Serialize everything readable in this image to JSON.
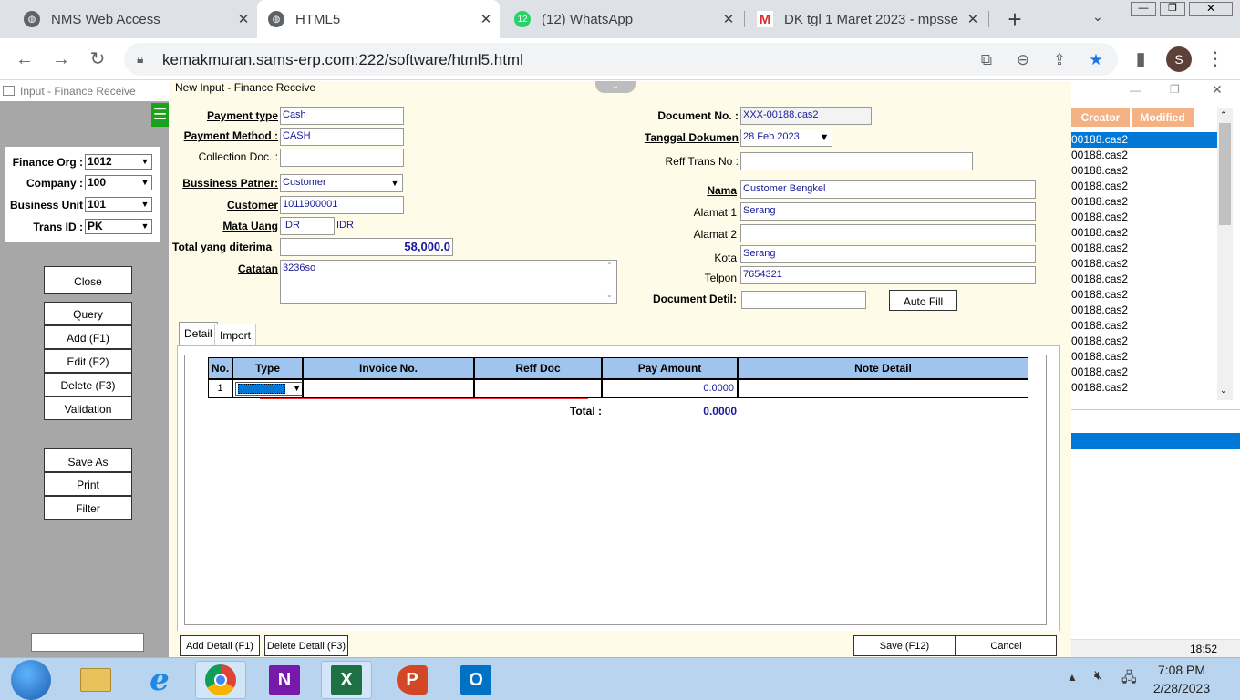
{
  "browser": {
    "tabs": [
      {
        "title": "NMS Web Access",
        "active": false
      },
      {
        "title": "HTML5",
        "active": true
      },
      {
        "title": "(12) WhatsApp",
        "active": false,
        "badge": "12"
      },
      {
        "title": "DK tgl 1 Maret 2023 - mpsse",
        "active": false
      }
    ],
    "new_tab": "+",
    "url": "kemakmuran.sams-erp.com:222/software/html5.html",
    "profile_initial": "S"
  },
  "left": {
    "title": "Input - Finance Receive",
    "filters": [
      {
        "label": "Finance Org :",
        "value": "1012"
      },
      {
        "label": "Company :",
        "value": "100"
      },
      {
        "label": "Business Unit",
        "value": "101"
      },
      {
        "label": "Trans ID :",
        "value": "PK"
      }
    ],
    "buttons": {
      "close": "Close",
      "query": "Query",
      "add": "Add (F1)",
      "edit": "Edit (F2)",
      "delete": "Delete (F3)",
      "validation": "Validation",
      "save_as": "Save As",
      "print": "Print",
      "filter": "Filter"
    }
  },
  "form": {
    "window_title": "New Input - Finance Receive",
    "payment_type": {
      "label": "Payment type",
      "value": "Cash"
    },
    "payment_method": {
      "label": "Payment Method :",
      "value": "CASH"
    },
    "collection_doc": {
      "label": "Collection Doc. :",
      "value": ""
    },
    "business_partner": {
      "label": "Bussiness Patner:",
      "value": "Customer"
    },
    "customer": {
      "label": "Customer",
      "value": "1011900001"
    },
    "currency": {
      "label": "Mata Uang",
      "value": "IDR",
      "display": "IDR"
    },
    "total": {
      "label": "Total yang diterima",
      "value": "58,000.0"
    },
    "notes": {
      "label": "Catatan",
      "value": "3236so"
    },
    "document_no": {
      "label": "Document No. :",
      "value": "XXX-00188.cas2"
    },
    "doc_date": {
      "label": "Tanggal Dokumen",
      "value": "28 Feb 2023"
    },
    "reff_trans_no": {
      "label": "Reff Trans No :",
      "value": ""
    },
    "name": {
      "label": "Nama",
      "value": "Customer Bengkel"
    },
    "address1": {
      "label": "Alamat 1",
      "value": "Serang"
    },
    "address2": {
      "label": "Alamat 2",
      "value": ""
    },
    "city": {
      "label": "Kota",
      "value": "Serang"
    },
    "phone": {
      "label": "Telpon",
      "value": "7654321"
    },
    "document_detail": {
      "label": "Document Detil:",
      "value": ""
    },
    "auto_fill": "Auto Fill"
  },
  "detail": {
    "tabs": [
      "Detail",
      "Import"
    ],
    "columns": [
      "No.",
      "Type",
      "Invoice No.",
      "Reff Doc",
      "Pay Amount",
      "Note Detail"
    ],
    "rows": [
      {
        "no": "1",
        "type": "",
        "invoice": "",
        "reff": "",
        "amount": "0.0000",
        "note": ""
      }
    ],
    "total_label": "Total :",
    "total_value": "0.0000",
    "add_detail": "Add Detail (F1)",
    "delete_detail": "Delete Detail (F3)",
    "save": "Save (F12)",
    "cancel": "Cancel"
  },
  "right": {
    "columns": [
      "Creator",
      "Modified"
    ],
    "items": [
      "00188.cas2",
      "00188.cas2",
      "00188.cas2",
      "00188.cas2",
      "00188.cas2",
      "00188.cas2",
      "00188.cas2",
      "00188.cas2",
      "00188.cas2",
      "00188.cas2",
      "00188.cas2",
      "00188.cas2",
      "00188.cas2",
      "00188.cas2",
      "00188.cas2",
      "00188.cas2",
      "00188.cas2"
    ],
    "time": "18:52"
  },
  "taskbar": {
    "time": "7:08 PM",
    "date": "2/28/2023"
  },
  "colors": {
    "grid_header": "#9fc5ee",
    "form_bg": "#fefbe8",
    "selection": "#0078d7",
    "right_header": "#f4b183"
  }
}
